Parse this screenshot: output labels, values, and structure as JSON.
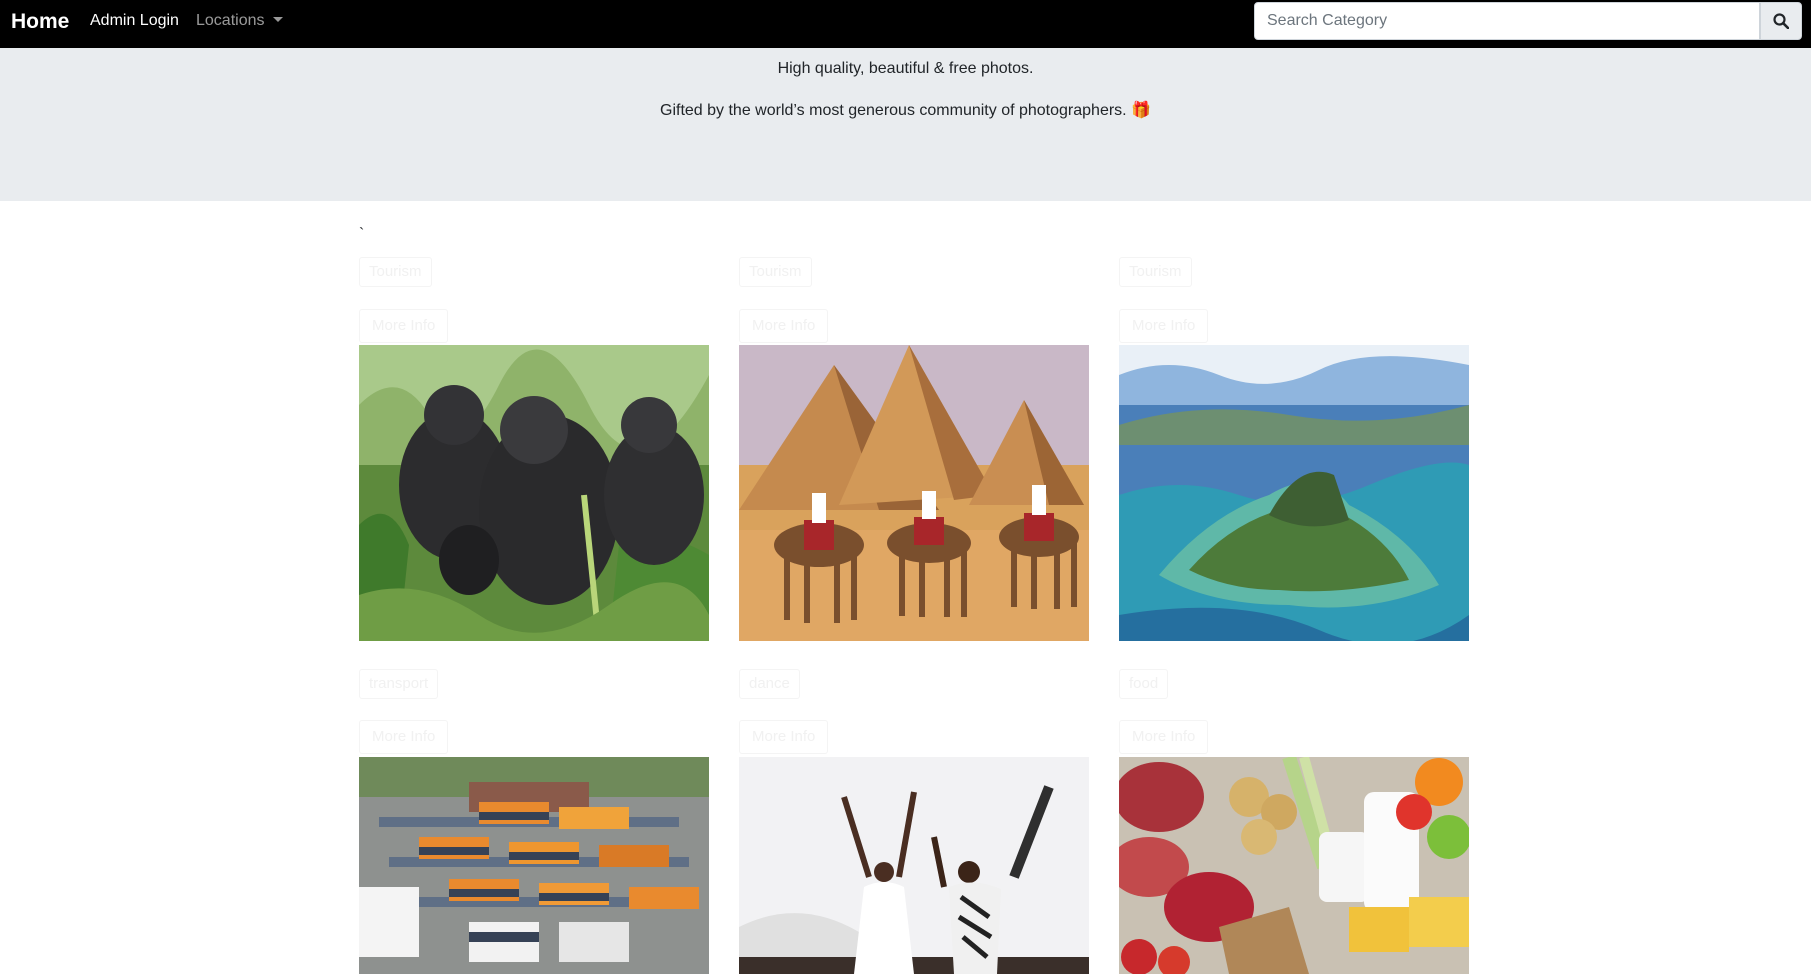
{
  "navbar": {
    "brand": "Home",
    "admin_login": "Admin Login",
    "locations": "Locations",
    "search_placeholder": "Search Category"
  },
  "hero": {
    "line1": "High quality, beautiful & free photos.",
    "line2": "Gifted by the world’s most generous community of photographers. 🎁"
  },
  "stray_text": "`",
  "cards": [
    {
      "category": "Tourism",
      "button": "More Info",
      "image": "gorillas"
    },
    {
      "category": "Tourism",
      "button": "More Info",
      "image": "pyramids-camels"
    },
    {
      "category": "Tourism",
      "button": "More Info",
      "image": "island-aerial"
    },
    {
      "category": "transport",
      "button": "More Info",
      "image": "bus-station"
    },
    {
      "category": "dance",
      "button": "More Info",
      "image": "dancers"
    },
    {
      "category": "food",
      "button": "More Info",
      "image": "food-assortment"
    }
  ]
}
